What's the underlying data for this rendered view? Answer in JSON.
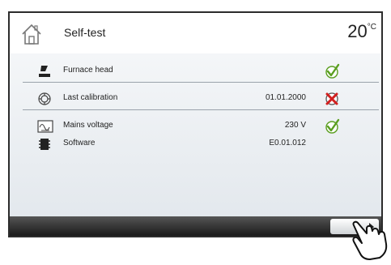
{
  "header": {
    "title": "Self-test",
    "temperature": "20",
    "temperature_unit": "°C",
    "home_icon": "home-icon"
  },
  "rows": [
    {
      "label": "Furnace head",
      "value": "",
      "icon": "furnace-head-icon",
      "status": "ok"
    },
    {
      "label": "Last calibration",
      "value": "01.01.2000",
      "icon": "calibration-icon",
      "status": "error"
    },
    {
      "label": "Mains voltage",
      "value": "230 V",
      "icon": "mains-voltage-icon",
      "status": "ok"
    },
    {
      "label": "Software",
      "value": "E0.01.012",
      "icon": "software-chip-icon",
      "status": "none"
    }
  ],
  "footer": {
    "next_icon": "arrow-right-icon"
  },
  "colors": {
    "ok": "#5a9e1f",
    "error": "#d21f1f",
    "separator": "#9aa3ab",
    "bottom_bar": "#2a2a2a"
  }
}
